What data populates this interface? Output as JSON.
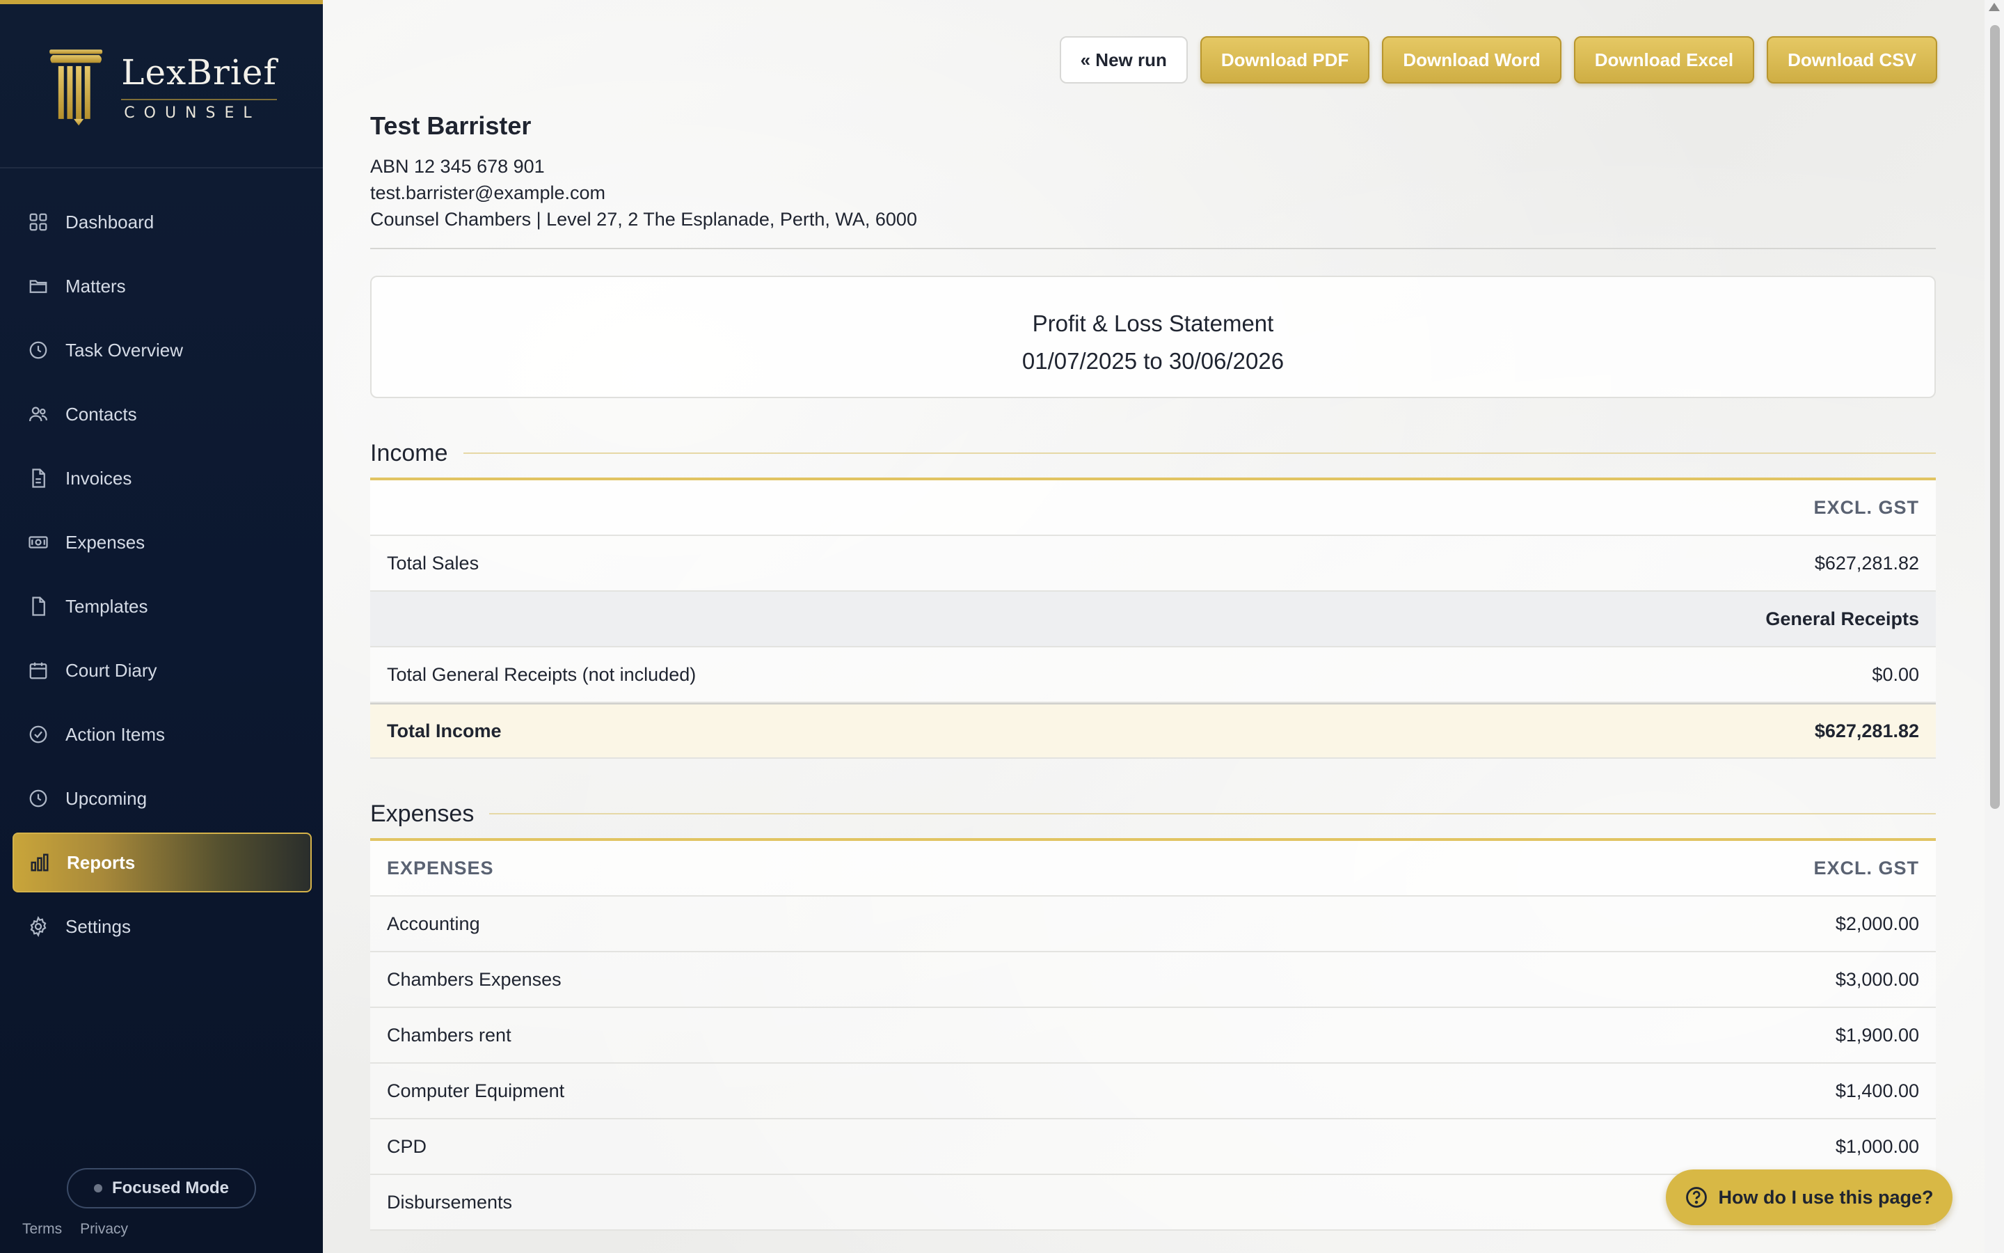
{
  "brand": {
    "name": "LexBrief",
    "sub": "COUNSEL",
    "colors": {
      "navy": "#0c1830",
      "gold": "#c9a53a"
    }
  },
  "sidebar": {
    "items": [
      {
        "label": "Dashboard",
        "icon": "grid-icon"
      },
      {
        "label": "Matters",
        "icon": "folder-icon"
      },
      {
        "label": "Task Overview",
        "icon": "clock-icon"
      },
      {
        "label": "Contacts",
        "icon": "users-icon"
      },
      {
        "label": "Invoices",
        "icon": "document-icon"
      },
      {
        "label": "Expenses",
        "icon": "banknote-icon"
      },
      {
        "label": "Templates",
        "icon": "file-icon"
      },
      {
        "label": "Court Diary",
        "icon": "calendar-icon"
      },
      {
        "label": "Action Items",
        "icon": "check-circle-icon"
      },
      {
        "label": "Upcoming",
        "icon": "clock-icon"
      },
      {
        "label": "Reports",
        "icon": "bar-chart-icon",
        "active": true
      },
      {
        "label": "Settings",
        "icon": "gear-icon"
      }
    ],
    "focused_mode": "Focused Mode",
    "footer": {
      "terms": "Terms",
      "privacy": "Privacy"
    }
  },
  "toolbar": {
    "new_run": "« New run",
    "download_pdf": "Download PDF",
    "download_word": "Download Word",
    "download_excel": "Download Excel",
    "download_csv": "Download CSV"
  },
  "firm": {
    "name": "Test Barrister",
    "abn": "ABN 12 345 678 901",
    "email": "test.barrister@example.com",
    "address": "Counsel Chambers | Level 27, 2 The Esplanade, Perth, WA, 6000"
  },
  "report": {
    "title": "Profit & Loss Statement",
    "period": "01/07/2025 to 30/06/2026"
  },
  "income": {
    "title": "Income",
    "col_header": "EXCL. GST",
    "total_sales_label": "Total Sales",
    "total_sales": "$627,281.82",
    "general_receipts_header": "General Receipts",
    "general_receipts_label": "Total General Receipts (not included)",
    "general_receipts": "$0.00",
    "total_label": "Total Income",
    "total": "$627,281.82"
  },
  "expenses": {
    "title": "Expenses",
    "col_label": "EXPENSES",
    "col_header": "EXCL. GST",
    "rows": [
      {
        "label": "Accounting",
        "amount": "$2,000.00"
      },
      {
        "label": "Chambers Expenses",
        "amount": "$3,000.00"
      },
      {
        "label": "Chambers rent",
        "amount": "$1,900.00"
      },
      {
        "label": "Computer Equipment",
        "amount": "$1,400.00"
      },
      {
        "label": "CPD",
        "amount": "$1,000.00"
      },
      {
        "label": "Disbursements",
        "amount": ""
      }
    ]
  },
  "help": {
    "label": "How do I use this page?"
  }
}
